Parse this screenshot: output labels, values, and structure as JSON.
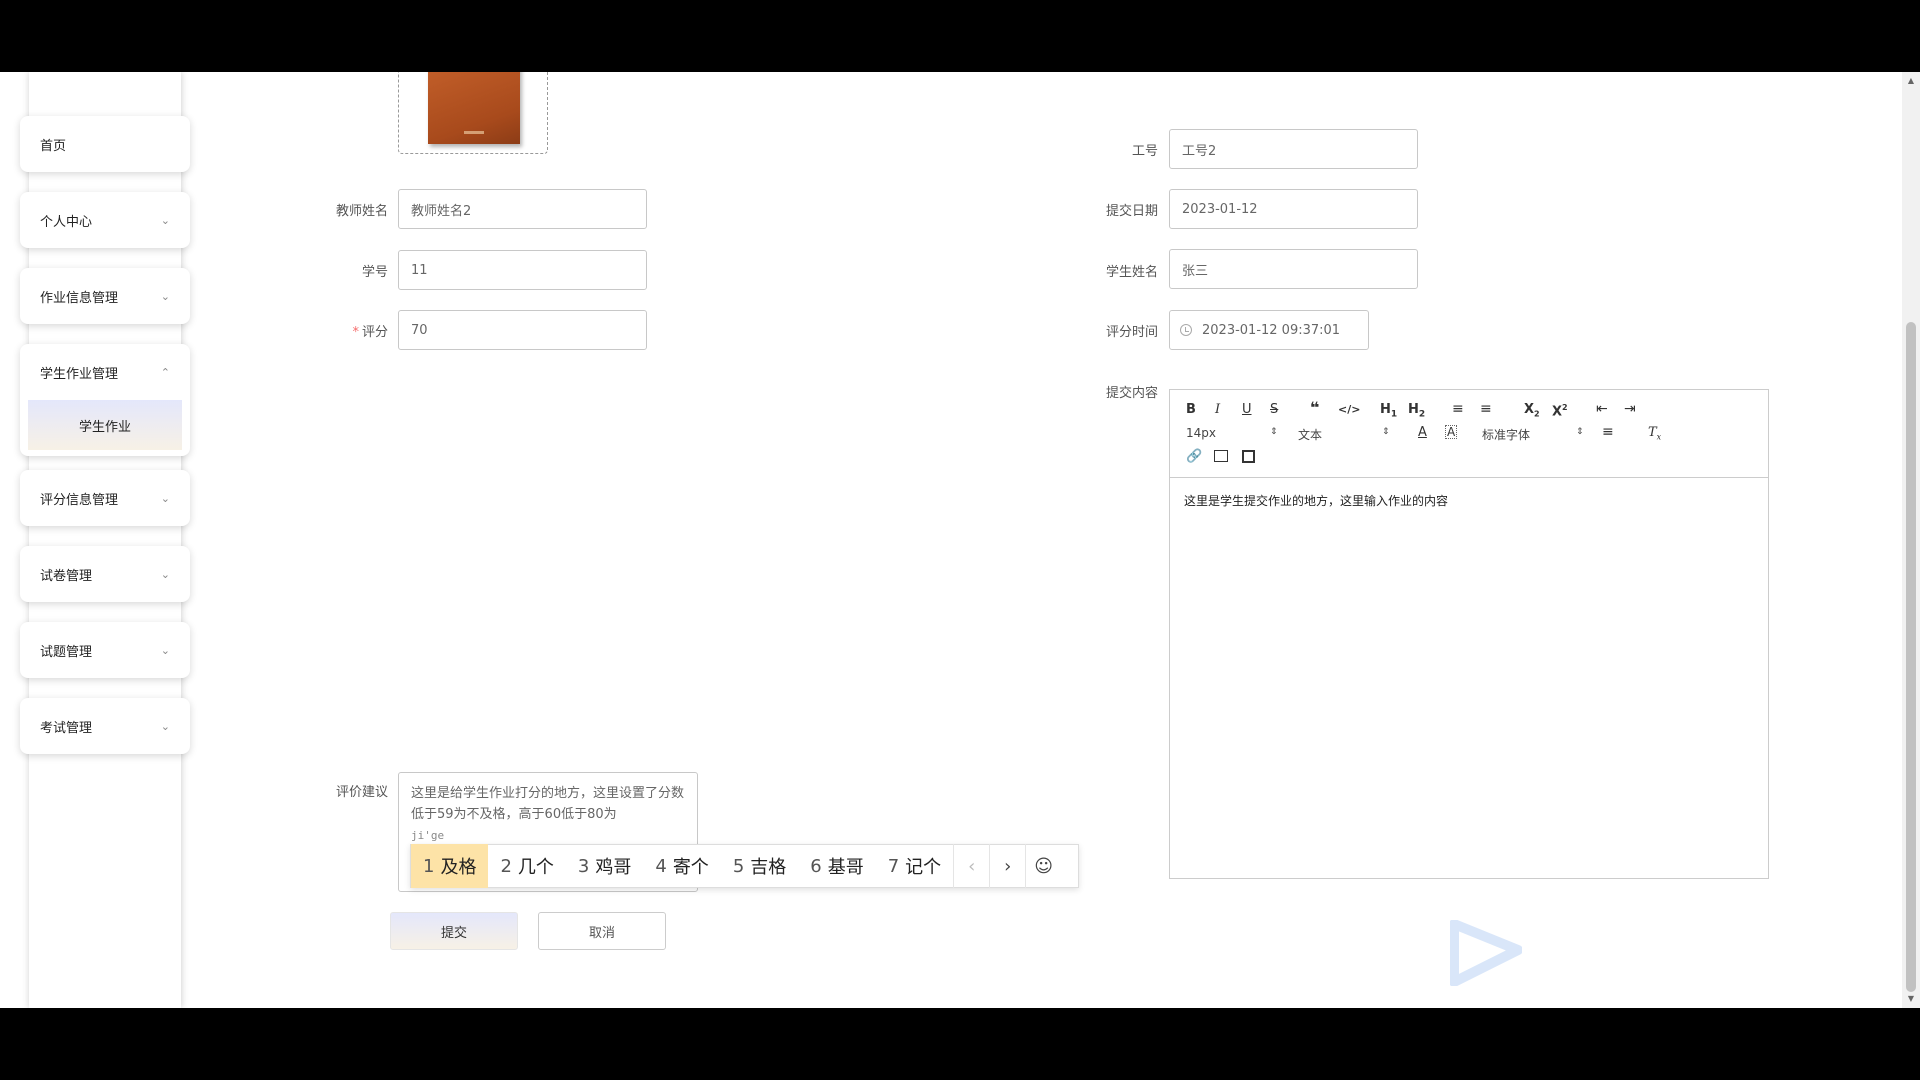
{
  "sidebar": {
    "home": "首页",
    "personal": "个人中心",
    "homework_info": "作业信息管理",
    "student_homework": "学生作业管理",
    "student_homework_sub": "学生作业",
    "grading_info": "评分信息管理",
    "paper_mgmt": "试卷管理",
    "question_mgmt": "试题管理",
    "exam_mgmt": "考试管理"
  },
  "form": {
    "teacher_name_label": "教师姓名",
    "teacher_name_value": "教师姓名2",
    "student_no_label": "学号",
    "student_no_value": "11",
    "score_label": "评分",
    "score_required": "*",
    "score_value": "70",
    "job_no_label": "工号",
    "job_no_value": "工号2",
    "submit_date_label": "提交日期",
    "submit_date_value": "2023-01-12",
    "student_name_label": "学生姓名",
    "student_name_value": "张三",
    "grading_time_label": "评分时间",
    "grading_time_value": "2023-01-12 09:37:01",
    "content_label": "提交内容",
    "content_value": "这里是学生提交作业的地方，这里输入作业的内容",
    "suggestion_label": "评价建议",
    "suggestion_text": "这里是给学生作业打分的地方，这里设置了分数低于59为不及格，高于60低于80为",
    "suggestion_pinyin": "ji'ge"
  },
  "editor_toolbar": {
    "font_size": "14px",
    "header_select": "文本",
    "font_family": "标准字体",
    "h1": "H1",
    "h2": "H2",
    "sub": "X2",
    "sup": "X2"
  },
  "ime": {
    "candidates": [
      {
        "n": "1",
        "text": "及格"
      },
      {
        "n": "2",
        "text": "几个"
      },
      {
        "n": "3",
        "text": "鸡哥"
      },
      {
        "n": "4",
        "text": "寄个"
      },
      {
        "n": "5",
        "text": "吉格"
      },
      {
        "n": "6",
        "text": "基哥"
      },
      {
        "n": "7",
        "text": "记个"
      }
    ],
    "prev": "‹",
    "next": "›",
    "emoji": "☺"
  },
  "buttons": {
    "submit": "提交",
    "cancel": "取消"
  },
  "colors": {
    "accent_gradient_start": "#e4e7fb",
    "accent_gradient_end": "#f7f1e6",
    "required": "#f56c6c",
    "ime_selected": "#fde3a7"
  }
}
